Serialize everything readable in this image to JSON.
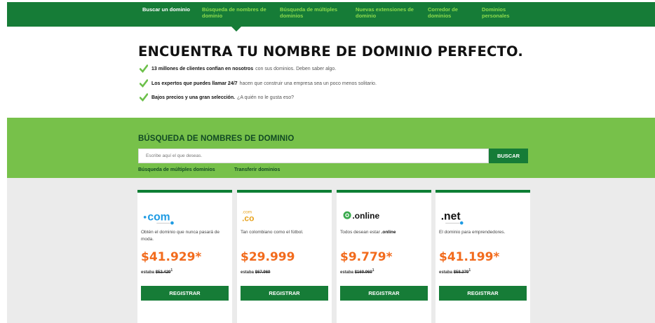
{
  "nav": {
    "items": [
      {
        "label": "Buscar un dominio",
        "state": "active"
      },
      {
        "label": "Búsqueda de nombres de dominio",
        "state": "selected"
      },
      {
        "label": "Búsqueda de múltiples dominios",
        "state": ""
      },
      {
        "label": "Nuevas extensiones de dominio",
        "state": ""
      },
      {
        "label": "Corredor de dominios",
        "state": ""
      },
      {
        "label": "Dominios personales",
        "state": ""
      }
    ]
  },
  "hero": {
    "title": "ENCUENTRA TU NOMBRE DE DOMINIO PERFECTO.",
    "bullets": [
      {
        "bold": "13 millones de clientes confían en nosotros",
        "text": "con sus dominios. Deben saber algo."
      },
      {
        "bold": "Los expertos que puedes llamar 24/7",
        "text": "hacen que construir una empresa sea un poco menos solitario."
      },
      {
        "bold": "Bajos precios y una gran selección.",
        "text": "¿A quién no le gusta eso?"
      }
    ]
  },
  "search": {
    "title": "BÚSQUEDA DE NOMBRES DE DOMINIO",
    "placeholder": "Escribe aquí el que deseas.",
    "button": "BUSCAR",
    "links": [
      "Búsqueda de múltiples dominios",
      "Transferir dominios"
    ]
  },
  "cards": [
    {
      "tld": ".com",
      "desc": "Obtén el dominio que nunca pasará de moda.",
      "desc_bold": "",
      "price": "$41.929*",
      "was_label": "estaba",
      "was_price": "$52.429",
      "was_sup": "1",
      "button": "REGISTRAR"
    },
    {
      "tld": ".co",
      "tld_small": "com",
      "desc": "Tan colombiano como el fútbol.",
      "desc_bold": "",
      "price": "$29.999",
      "was_label": "estaba",
      "was_price": "$67.969",
      "was_sup": "",
      "button": "REGISTRAR"
    },
    {
      "tld": ".online",
      "desc": "Todos desean estar ",
      "desc_bold": ".online",
      "price": "$9.779*",
      "was_label": "estaba",
      "was_price": "$169.969",
      "was_sup": "1",
      "button": "REGISTRAR"
    },
    {
      "tld": ".net",
      "desc": "El dominio para emprendedores.",
      "desc_bold": "",
      "price": "$41.199*",
      "was_label": "estaba",
      "was_price": "$58.379",
      "was_sup": "1",
      "button": "REGISTRAR"
    }
  ],
  "colors": {
    "brand_green": "#167c37",
    "light_green": "#77c14a",
    "price_orange": "#f26b1d",
    "check_green": "#6cc04a"
  }
}
